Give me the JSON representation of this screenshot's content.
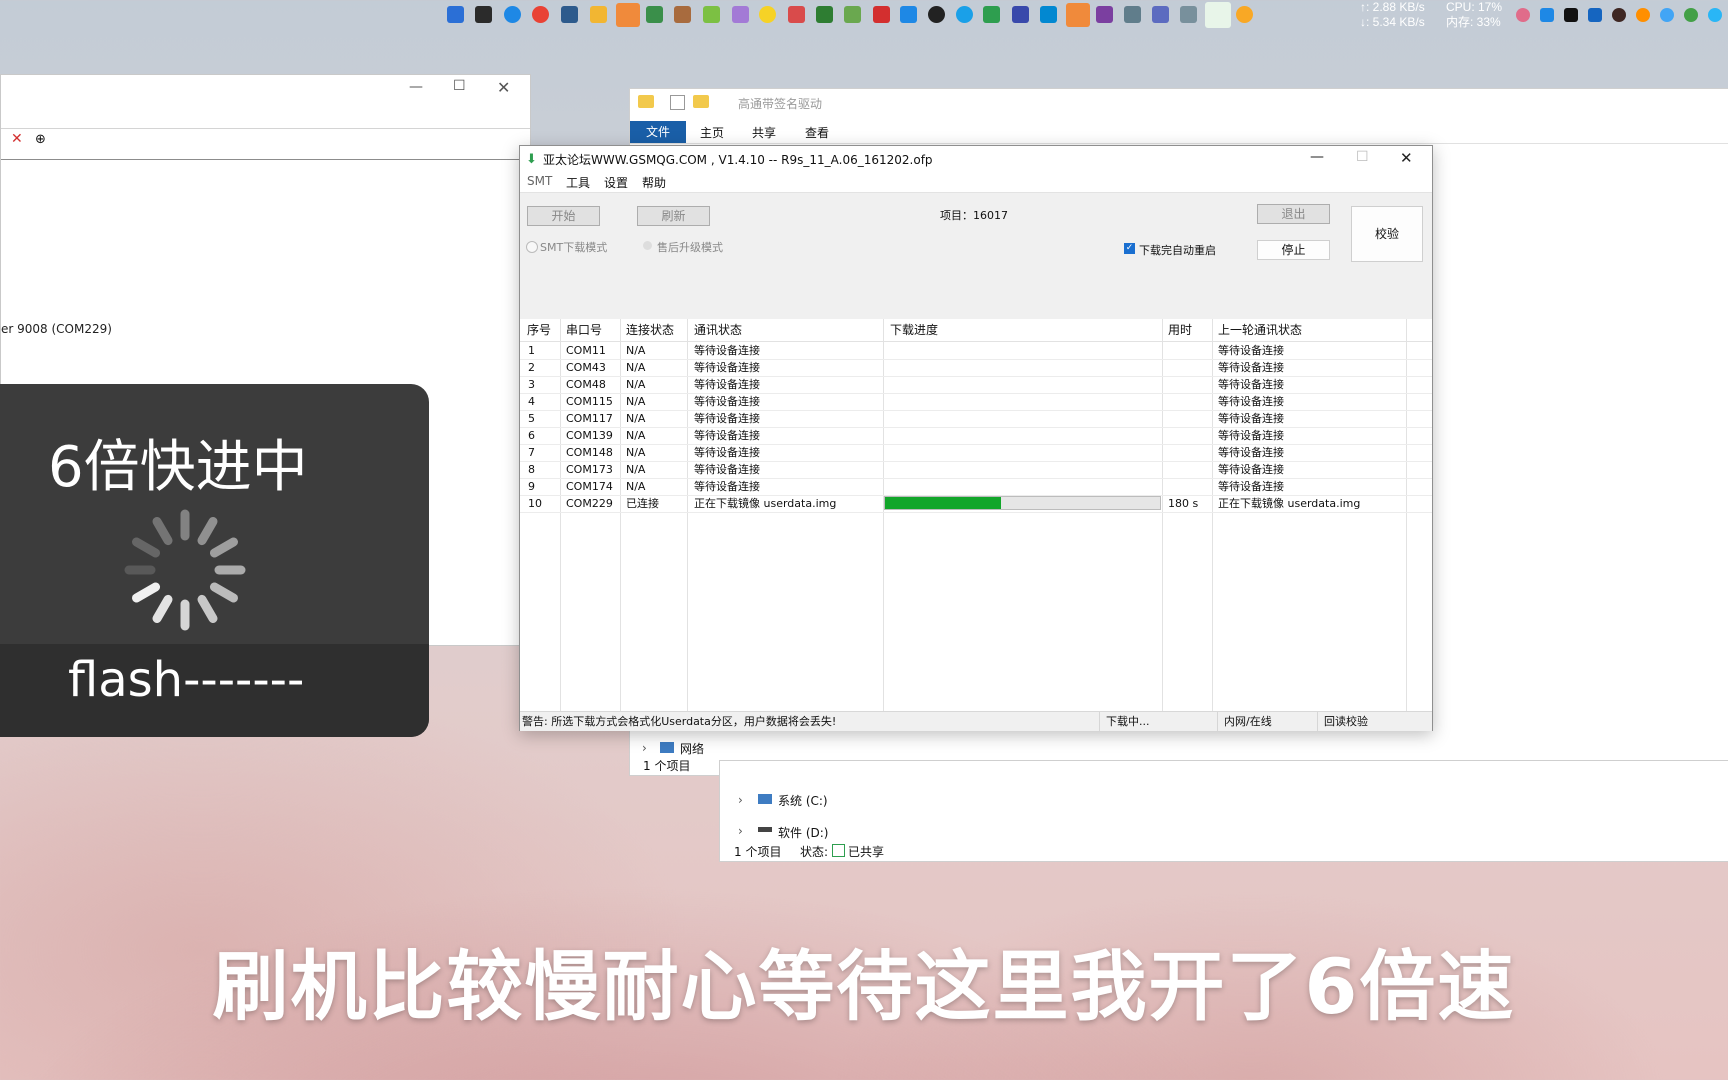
{
  "tray": {
    "net_up": "↑: 2.88 KB/s",
    "net_down": "↓: 5.34 KB/s",
    "cpu": "CPU: 17%",
    "mem": "内存: 33%"
  },
  "left_window": {
    "device_text": "er 9008 (COM229)"
  },
  "explorer": {
    "title": "高通带签名驱动",
    "ribbon_tabs": [
      "文件",
      "主页",
      "共享",
      "查看"
    ],
    "nav_network": "网络",
    "item_count": "1 个项目",
    "drive_c": "系统 (C:)",
    "drive_d": "软件 (D:)",
    "item_count2": "1 个项目",
    "status_label": "状态:",
    "status_value": "已共享"
  },
  "flash_tool": {
    "title": "亚太论坛WWW.GSMQG.COM    , V1.4.10 -- R9s_11_A.06_161202.ofp",
    "menu": [
      "SMT",
      "工具",
      "设置",
      "帮助"
    ],
    "start_label": "开始",
    "refresh_label": "刷新",
    "item_label": "项目：16017",
    "exit_label": "退出",
    "stop_label": "停止",
    "verify_label": "校验",
    "smt_mode": "SMT下载模式",
    "aftersale_mode": "售后升级模式",
    "auto_restart": "下载完自动重启",
    "auto_restart_checked": true,
    "columns": [
      "序号",
      "串口号",
      "连接状态",
      "通讯状态",
      "下载进度",
      "用时",
      "上一轮通讯状态"
    ],
    "rows": [
      {
        "no": "1",
        "port": "COM11",
        "conn": "N/A",
        "comm": "等待设备连接",
        "time": "",
        "last": "等待设备连接"
      },
      {
        "no": "2",
        "port": "COM43",
        "conn": "N/A",
        "comm": "等待设备连接",
        "time": "",
        "last": "等待设备连接"
      },
      {
        "no": "3",
        "port": "COM48",
        "conn": "N/A",
        "comm": "等待设备连接",
        "time": "",
        "last": "等待设备连接"
      },
      {
        "no": "4",
        "port": "COM115",
        "conn": "N/A",
        "comm": "等待设备连接",
        "time": "",
        "last": "等待设备连接"
      },
      {
        "no": "5",
        "port": "COM117",
        "conn": "N/A",
        "comm": "等待设备连接",
        "time": "",
        "last": "等待设备连接"
      },
      {
        "no": "6",
        "port": "COM139",
        "conn": "N/A",
        "comm": "等待设备连接",
        "time": "",
        "last": "等待设备连接"
      },
      {
        "no": "7",
        "port": "COM148",
        "conn": "N/A",
        "comm": "等待设备连接",
        "time": "",
        "last": "等待设备连接"
      },
      {
        "no": "8",
        "port": "COM173",
        "conn": "N/A",
        "comm": "等待设备连接",
        "time": "",
        "last": "等待设备连接"
      },
      {
        "no": "9",
        "port": "COM174",
        "conn": "N/A",
        "comm": "等待设备连接",
        "time": "",
        "last": "等待设备连接"
      },
      {
        "no": "10",
        "port": "COM229",
        "conn": "已连接",
        "comm": "正在下载镜像 userdata.img",
        "time": "180 s",
        "last": "正在下载镜像 userdata.img"
      }
    ],
    "progress_fraction": 0.42,
    "progress_color": "#12a62a",
    "status": {
      "warning": "警告: 所选下载方式会格式化Userdata分区，用户数据将会丢失!",
      "downloading": "下载中...",
      "network": "内网/在线",
      "verify": "回读校验"
    }
  },
  "overlay": {
    "title": "6倍快进中",
    "subtitle": "flash-------"
  },
  "caption": "刷机比较慢耐心等待这里我开了6倍速"
}
